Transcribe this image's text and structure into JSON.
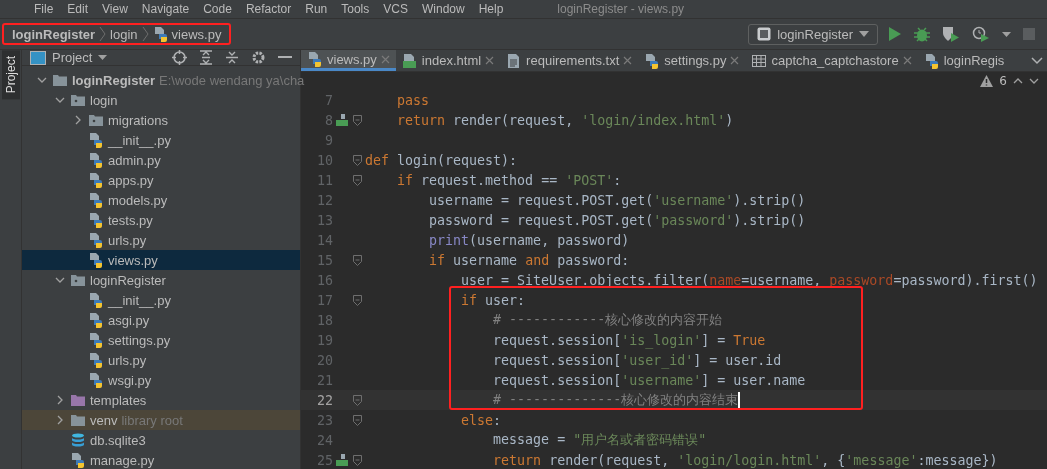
{
  "menu_bar": {
    "items": [
      "File",
      "Edit",
      "View",
      "Navigate",
      "Code",
      "Refactor",
      "Run",
      "Tools",
      "VCS",
      "Window",
      "Help"
    ],
    "title": "loginRegister - views.py"
  },
  "breadcrumb": {
    "framed": true,
    "items": [
      {
        "label": "loginRegister",
        "kind": "project"
      },
      {
        "label": "login",
        "kind": "folder"
      },
      {
        "label": "views.py",
        "kind": "python"
      }
    ]
  },
  "run_config": {
    "label": "loginRegister"
  },
  "tool_strip": {
    "label": "Project"
  },
  "project_panel": {
    "title": "Project"
  },
  "tree": [
    {
      "label": "loginRegister",
      "kind": "project",
      "hint": "E:\\wode wendang ya\\cha",
      "expanded": true,
      "selected": false,
      "children": [
        {
          "label": "login",
          "kind": "package",
          "expanded": true,
          "selected": false,
          "children": [
            {
              "label": "migrations",
              "kind": "package",
              "expanded": false,
              "selected": false
            },
            {
              "label": "__init__.py",
              "kind": "python",
              "selected": false
            },
            {
              "label": "admin.py",
              "kind": "python",
              "selected": false
            },
            {
              "label": "apps.py",
              "kind": "python",
              "selected": false
            },
            {
              "label": "models.py",
              "kind": "python",
              "selected": false
            },
            {
              "label": "tests.py",
              "kind": "python",
              "selected": false
            },
            {
              "label": "urls.py",
              "kind": "python",
              "selected": false
            },
            {
              "label": "views.py",
              "kind": "python",
              "selected": true
            }
          ]
        },
        {
          "label": "loginRegister",
          "kind": "package",
          "expanded": true,
          "selected": false,
          "children": [
            {
              "label": "__init__.py",
              "kind": "python",
              "selected": false
            },
            {
              "label": "asgi.py",
              "kind": "python",
              "selected": false
            },
            {
              "label": "settings.py",
              "kind": "python",
              "selected": false
            },
            {
              "label": "urls.py",
              "kind": "python",
              "selected": false
            },
            {
              "label": "wsgi.py",
              "kind": "python",
              "selected": false
            }
          ]
        },
        {
          "label": "templates",
          "kind": "templates",
          "expanded": false,
          "selected": false
        },
        {
          "label": "venv",
          "kind": "library",
          "hint": "library root",
          "expanded": false,
          "selected": false
        },
        {
          "label": "db.sqlite3",
          "kind": "database",
          "selected": false
        },
        {
          "label": "manage.py",
          "kind": "python",
          "selected": false
        }
      ]
    }
  ],
  "tabs": [
    {
      "label": "views.py",
      "kind": "python",
      "selected": true,
      "closable": true
    },
    {
      "label": "index.html",
      "kind": "html",
      "selected": false,
      "closable": true
    },
    {
      "label": "requirements.txt",
      "kind": "text",
      "selected": false,
      "closable": true
    },
    {
      "label": "settings.py",
      "kind": "python",
      "selected": false,
      "closable": true
    },
    {
      "label": "captcha_captchastore",
      "kind": "table",
      "selected": false,
      "closable": true
    },
    {
      "label": "loginRegis",
      "kind": "python",
      "selected": false,
      "closable": false
    }
  ],
  "inspection": {
    "count": "6"
  },
  "code_blocks": [
    {
      "framed": false,
      "lines": [
        {
          "number": "7",
          "fold": false,
          "marker": false,
          "current": false,
          "tokens": [
            {
              "kind": "kw",
              "text": "    pass"
            }
          ]
        },
        {
          "number": "8",
          "fold": true,
          "marker": true,
          "current": false,
          "tokens": [
            {
              "kind": "kw",
              "text": "    return"
            },
            {
              "kind": "plain",
              "text": " render(request, "
            },
            {
              "kind": "str",
              "text": "'login/index.html'"
            },
            {
              "kind": "plain",
              "text": ")"
            }
          ]
        },
        {
          "number": "9",
          "fold": false,
          "marker": false,
          "current": false
        },
        {
          "number": "10",
          "fold": true,
          "marker": false,
          "current": false,
          "tokens": [
            {
              "kind": "kw",
              "text": "def"
            },
            {
              "kind": "plain",
              "text": " login(request):"
            }
          ]
        },
        {
          "number": "11",
          "fold": true,
          "marker": false,
          "current": false,
          "tokens": [
            {
              "kind": "kw",
              "text": "    if"
            },
            {
              "kind": "plain",
              "text": " request.method == "
            },
            {
              "kind": "str",
              "text": "'POST'"
            },
            {
              "kind": "plain",
              "text": ":"
            }
          ]
        },
        {
          "number": "12",
          "fold": false,
          "marker": false,
          "current": false,
          "tokens": [
            {
              "kind": "plain",
              "text": "        username = request.POST.get("
            },
            {
              "kind": "str",
              "text": "'username'"
            },
            {
              "kind": "plain",
              "text": ").strip()"
            }
          ]
        },
        {
          "number": "13",
          "fold": false,
          "marker": false,
          "current": false,
          "tokens": [
            {
              "kind": "plain",
              "text": "        password = request.POST.get("
            },
            {
              "kind": "str",
              "text": "'password'"
            },
            {
              "kind": "plain",
              "text": ").strip()"
            }
          ]
        },
        {
          "number": "14",
          "fold": false,
          "marker": false,
          "current": false,
          "tokens": [
            {
              "kind": "builtin",
              "text": "        print"
            },
            {
              "kind": "plain",
              "text": "(username, password)"
            }
          ]
        },
        {
          "number": "15",
          "fold": true,
          "marker": false,
          "current": false,
          "tokens": [
            {
              "kind": "kw",
              "text": "        if"
            },
            {
              "kind": "plain",
              "text": " username "
            },
            {
              "kind": "kw",
              "text": "and"
            },
            {
              "kind": "plain",
              "text": " password:"
            }
          ]
        },
        {
          "number": "16",
          "fold": false,
          "marker": false,
          "current": false,
          "tokens": [
            {
              "kind": "plain",
              "text": "            user = SiteUser.objects.filter("
            },
            {
              "kind": "param",
              "text": "name"
            },
            {
              "kind": "plain",
              "text": "=username, "
            },
            {
              "kind": "param",
              "text": "password"
            },
            {
              "kind": "plain",
              "text": "=password).first()"
            }
          ]
        }
      ]
    },
    {
      "framed": true,
      "lines": [
        {
          "number": "17",
          "fold": true,
          "marker": false,
          "current": false,
          "tokens": [
            {
              "kind": "kw",
              "text": "            if"
            },
            {
              "kind": "plain",
              "text": " user:"
            }
          ]
        },
        {
          "number": "18",
          "fold": false,
          "marker": false,
          "current": false,
          "tokens": [
            {
              "kind": "comment",
              "text": "                # ------------核心修改的内容开始"
            }
          ]
        },
        {
          "number": "19",
          "fold": false,
          "marker": false,
          "current": false,
          "tokens": [
            {
              "kind": "plain",
              "text": "                request.session["
            },
            {
              "kind": "str",
              "text": "'is_login'"
            },
            {
              "kind": "plain",
              "text": "] = "
            },
            {
              "kind": "kw",
              "text": "True"
            }
          ]
        },
        {
          "number": "20",
          "fold": false,
          "marker": false,
          "current": false,
          "tokens": [
            {
              "kind": "plain",
              "text": "                request.session["
            },
            {
              "kind": "str",
              "text": "'user_id'"
            },
            {
              "kind": "plain",
              "text": "] = user.id"
            }
          ]
        },
        {
          "number": "21",
          "fold": false,
          "marker": false,
          "current": false,
          "tokens": [
            {
              "kind": "plain",
              "text": "                request.session["
            },
            {
              "kind": "str",
              "text": "'username'"
            },
            {
              "kind": "plain",
              "text": "] = user.name"
            }
          ]
        },
        {
          "number": "22",
          "fold": true,
          "marker": false,
          "current": true,
          "tokens": [
            {
              "kind": "comment",
              "text": "                # --------------核心修改的内容结束"
            }
          ]
        }
      ]
    },
    {
      "framed": false,
      "lines": [
        {
          "number": "23",
          "fold": true,
          "marker": false,
          "current": false,
          "tokens": [
            {
              "kind": "kw",
              "text": "            else"
            },
            {
              "kind": "plain",
              "text": ":"
            }
          ]
        },
        {
          "number": "24",
          "fold": false,
          "marker": false,
          "current": false,
          "tokens": [
            {
              "kind": "plain",
              "text": "                message = "
            },
            {
              "kind": "str",
              "text": "\"用户名或者密码错误\""
            }
          ]
        },
        {
          "number": "25",
          "fold": true,
          "marker": true,
          "current": false,
          "tokens": [
            {
              "kind": "kw",
              "text": "                return"
            },
            {
              "kind": "plain",
              "text": " render(request, "
            },
            {
              "kind": "str",
              "text": "'login/login.html'"
            },
            {
              "kind": "plain",
              "text": ", {"
            },
            {
              "kind": "str",
              "text": "'message'"
            },
            {
              "kind": "plain",
              "text": ":message})"
            }
          ]
        }
      ]
    }
  ]
}
